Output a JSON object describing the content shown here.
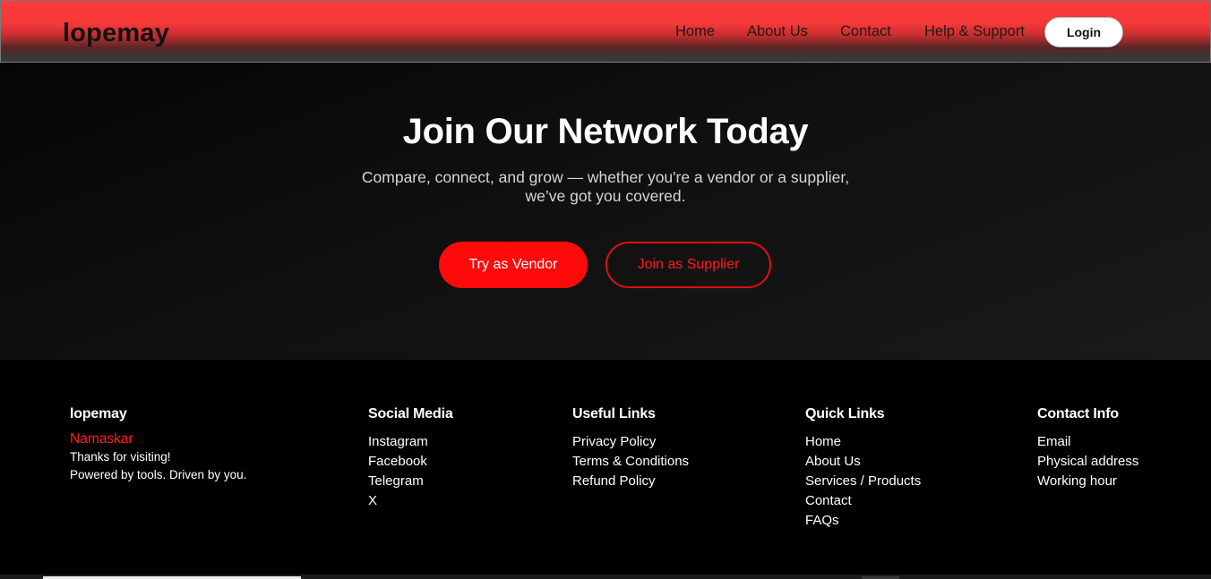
{
  "header": {
    "brand": "lopemay",
    "nav": [
      {
        "label": "Home"
      },
      {
        "label": "About Us"
      },
      {
        "label": "Contact"
      },
      {
        "label": "Help & Support"
      }
    ],
    "login_label": "Login"
  },
  "hero": {
    "title": "Join Our Network Today",
    "subtitle_line1": "Compare, connect, and grow — whether you're a vendor or a supplier,",
    "subtitle_line2": "we’ve got you covered.",
    "primary_button": "Try as Vendor",
    "secondary_button": "Join as Supplier"
  },
  "footer": {
    "brand": {
      "title": "lopemay",
      "greeting": "Namaskar",
      "line1": "Thanks for visiting!",
      "line2": "Powered by tools. Driven by you."
    },
    "social": {
      "title": "Social Media",
      "links": [
        "Instagram",
        "Facebook",
        "Telegram",
        "X"
      ]
    },
    "useful": {
      "title": "Useful Links",
      "links": [
        "Privacy Policy",
        "Terms & Conditions",
        "Refund Policy"
      ]
    },
    "quick": {
      "title": "Quick Links",
      "links": [
        "Home",
        "About Us",
        "Services / Products",
        "Contact",
        "FAQs"
      ]
    },
    "contact": {
      "title": "Contact Info",
      "links": [
        "Email",
        "Physical address",
        "Working hour"
      ]
    }
  },
  "colors": {
    "accent": "#ff0a0a",
    "header_top": "#ff3a3a",
    "background": "#000000"
  }
}
